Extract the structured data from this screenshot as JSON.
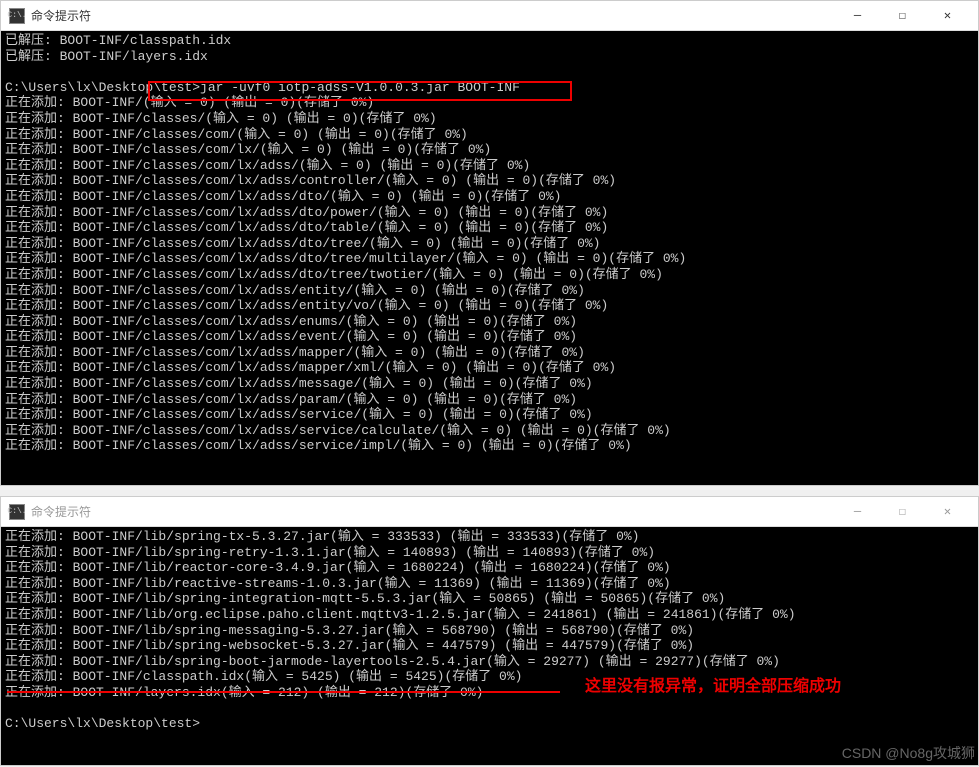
{
  "window1": {
    "title": "命令提示符",
    "lines": [
      "已解压: BOOT-INF/classpath.idx",
      "已解压: BOOT-INF/layers.idx",
      "",
      "C:\\Users\\lx\\Desktop\\test>jar -uvf0 iotp-adss-V1.0.0.3.jar BOOT-INF",
      "正在添加: BOOT-INF/(输入 = 0) (输出 = 0)(存储了 0%)",
      "正在添加: BOOT-INF/classes/(输入 = 0) (输出 = 0)(存储了 0%)",
      "正在添加: BOOT-INF/classes/com/(输入 = 0) (输出 = 0)(存储了 0%)",
      "正在添加: BOOT-INF/classes/com/lx/(输入 = 0) (输出 = 0)(存储了 0%)",
      "正在添加: BOOT-INF/classes/com/lx/adss/(输入 = 0) (输出 = 0)(存储了 0%)",
      "正在添加: BOOT-INF/classes/com/lx/adss/controller/(输入 = 0) (输出 = 0)(存储了 0%)",
      "正在添加: BOOT-INF/classes/com/lx/adss/dto/(输入 = 0) (输出 = 0)(存储了 0%)",
      "正在添加: BOOT-INF/classes/com/lx/adss/dto/power/(输入 = 0) (输出 = 0)(存储了 0%)",
      "正在添加: BOOT-INF/classes/com/lx/adss/dto/table/(输入 = 0) (输出 = 0)(存储了 0%)",
      "正在添加: BOOT-INF/classes/com/lx/adss/dto/tree/(输入 = 0) (输出 = 0)(存储了 0%)",
      "正在添加: BOOT-INF/classes/com/lx/adss/dto/tree/multilayer/(输入 = 0) (输出 = 0)(存储了 0%)",
      "正在添加: BOOT-INF/classes/com/lx/adss/dto/tree/twotier/(输入 = 0) (输出 = 0)(存储了 0%)",
      "正在添加: BOOT-INF/classes/com/lx/adss/entity/(输入 = 0) (输出 = 0)(存储了 0%)",
      "正在添加: BOOT-INF/classes/com/lx/adss/entity/vo/(输入 = 0) (输出 = 0)(存储了 0%)",
      "正在添加: BOOT-INF/classes/com/lx/adss/enums/(输入 = 0) (输出 = 0)(存储了 0%)",
      "正在添加: BOOT-INF/classes/com/lx/adss/event/(输入 = 0) (输出 = 0)(存储了 0%)",
      "正在添加: BOOT-INF/classes/com/lx/adss/mapper/(输入 = 0) (输出 = 0)(存储了 0%)",
      "正在添加: BOOT-INF/classes/com/lx/adss/mapper/xml/(输入 = 0) (输出 = 0)(存储了 0%)",
      "正在添加: BOOT-INF/classes/com/lx/adss/message/(输入 = 0) (输出 = 0)(存储了 0%)",
      "正在添加: BOOT-INF/classes/com/lx/adss/param/(输入 = 0) (输出 = 0)(存储了 0%)",
      "正在添加: BOOT-INF/classes/com/lx/adss/service/(输入 = 0) (输出 = 0)(存储了 0%)",
      "正在添加: BOOT-INF/classes/com/lx/adss/service/calculate/(输入 = 0) (输出 = 0)(存储了 0%)",
      "正在添加: BOOT-INF/classes/com/lx/adss/service/impl/(输入 = 0) (输出 = 0)(存储了 0%)"
    ]
  },
  "window2": {
    "title": "命令提示符",
    "lines": [
      "正在添加: BOOT-INF/lib/spring-tx-5.3.27.jar(输入 = 333533) (输出 = 333533)(存储了 0%)",
      "正在添加: BOOT-INF/lib/spring-retry-1.3.1.jar(输入 = 140893) (输出 = 140893)(存储了 0%)",
      "正在添加: BOOT-INF/lib/reactor-core-3.4.9.jar(输入 = 1680224) (输出 = 1680224)(存储了 0%)",
      "正在添加: BOOT-INF/lib/reactive-streams-1.0.3.jar(输入 = 11369) (输出 = 11369)(存储了 0%)",
      "正在添加: BOOT-INF/lib/spring-integration-mqtt-5.5.3.jar(输入 = 50865) (输出 = 50865)(存储了 0%)",
      "正在添加: BOOT-INF/lib/org.eclipse.paho.client.mqttv3-1.2.5.jar(输入 = 241861) (输出 = 241861)(存储了 0%)",
      "正在添加: BOOT-INF/lib/spring-messaging-5.3.27.jar(输入 = 568790) (输出 = 568790)(存储了 0%)",
      "正在添加: BOOT-INF/lib/spring-websocket-5.3.27.jar(输入 = 447579) (输出 = 447579)(存储了 0%)",
      "正在添加: BOOT-INF/lib/spring-boot-jarmode-layertools-2.5.4.jar(输入 = 29277) (输出 = 29277)(存储了 0%)",
      "正在添加: BOOT-INF/classpath.idx(输入 = 5425) (输出 = 5425)(存储了 0%)",
      "正在添加: BOOT-INF/layers.idx(输入 = 212) (输出 = 212)(存储了 0%)",
      "",
      "C:\\Users\\lx\\Desktop\\test>"
    ]
  },
  "annotation": {
    "red_text": "这里没有报异常，证明全部压缩成功"
  },
  "watermark": "CSDN @No8g攻城狮",
  "icon_text": "C:\\."
}
